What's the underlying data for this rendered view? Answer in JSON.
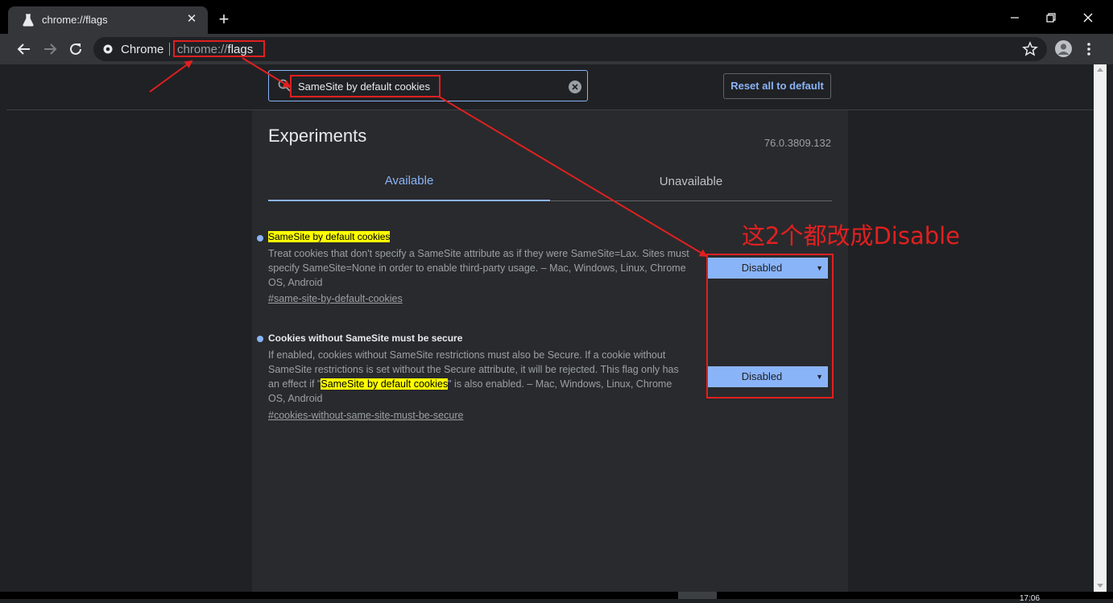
{
  "window": {
    "tab_title": "chrome://flags",
    "tab_close": "✕",
    "new_tab": "+"
  },
  "toolbar": {
    "chrome_label": "Chrome",
    "url_scheme": "chrome://",
    "url_host": "flags"
  },
  "header": {
    "search_value": "SameSite by default cookies",
    "reset_label": "Reset all to default"
  },
  "main": {
    "title": "Experiments",
    "version": "76.0.3809.132",
    "tabs": [
      {
        "label": "Available",
        "active": true
      },
      {
        "label": "Unavailable",
        "active": false
      }
    ]
  },
  "flags": [
    {
      "name": "SameSite by default cookies",
      "description": "Treat cookies that don't specify a SameSite attribute as if they were SameSite=Lax. Sites must specify SameSite=None in order to enable third-party usage. – Mac, Windows, Linux, Chrome OS, Android",
      "link": "#same-site-by-default-cookies",
      "value": "Disabled"
    },
    {
      "name": "Cookies without SameSite must be secure",
      "description_line1": "If enabled, cookies without SameSite restrictions must also be Secure. If a cookie without",
      "description_line2": "SameSite restrictions is set without the Secure attribute, it will be rejected. This flag only has",
      "description_pre": "an effect if \"",
      "description_highlight": "SameSite by default cookies",
      "description_post": "\" is also enabled. – Mac, Windows, Linux, Chrome",
      "description_line4": "OS, Android",
      "link": "#cookies-without-same-site-must-be-secure",
      "value": "Disabled"
    }
  ],
  "annotation": {
    "text": "这2个都改成Disable",
    "color": "#e02020"
  },
  "taskbar": {
    "clock_fragment": "17:06"
  },
  "colors": {
    "accent": "#8ab4f8",
    "highlight": "#ffff00",
    "annotation": "#e02020"
  }
}
